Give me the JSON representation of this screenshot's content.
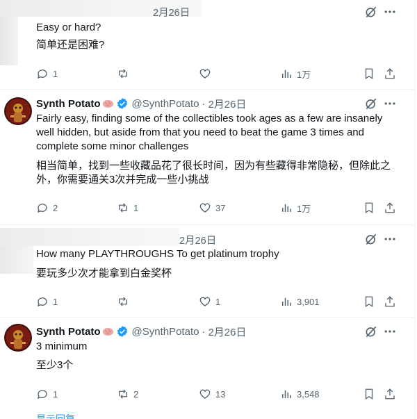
{
  "posts": [
    {
      "date": "2月26日",
      "text_en": "Easy or hard?",
      "text_zh": "简单还是困难?",
      "actions": {
        "replies": "1",
        "retweets": "",
        "likes": "",
        "views": "1万"
      }
    },
    {
      "author": "Synth Potato",
      "handle": "@SynthPotato",
      "separator": "·",
      "date": "2月26日",
      "text_en": "Fairly easy, finding some of the collectibles took ages as a few are insanely well hidden, but aside from that you need to beat the game 3 times and complete some minor challenges",
      "text_zh": "相当简单，找到一些收藏品花了很长时间，因为有些藏得非常隐秘，但除此之外，你需要通关3次并完成一些小挑战",
      "actions": {
        "replies": "2",
        "retweets": "1",
        "likes": "37",
        "views": "1万"
      }
    },
    {
      "date": "2月26日",
      "text_en": "How many PLAYTHROUGHS To get platinum trophy",
      "text_zh": "要玩多少次才能拿到白金奖杯",
      "actions": {
        "replies": "1",
        "retweets": "",
        "likes": "1",
        "views": "3,901"
      }
    },
    {
      "author": "Synth Potato",
      "handle": "@SynthPotato",
      "separator": "·",
      "date": "2月26日",
      "text_en": "3 minimum",
      "text_zh": "至少3个",
      "actions": {
        "replies": "1",
        "retweets": "2",
        "likes": "13",
        "views": "3,548"
      }
    }
  ],
  "footer": {
    "link": "显示回复"
  },
  "colors": {
    "text": "#0f1419",
    "muted": "#536471",
    "accent": "#1d9bf0",
    "divider": "#eff3f4"
  }
}
